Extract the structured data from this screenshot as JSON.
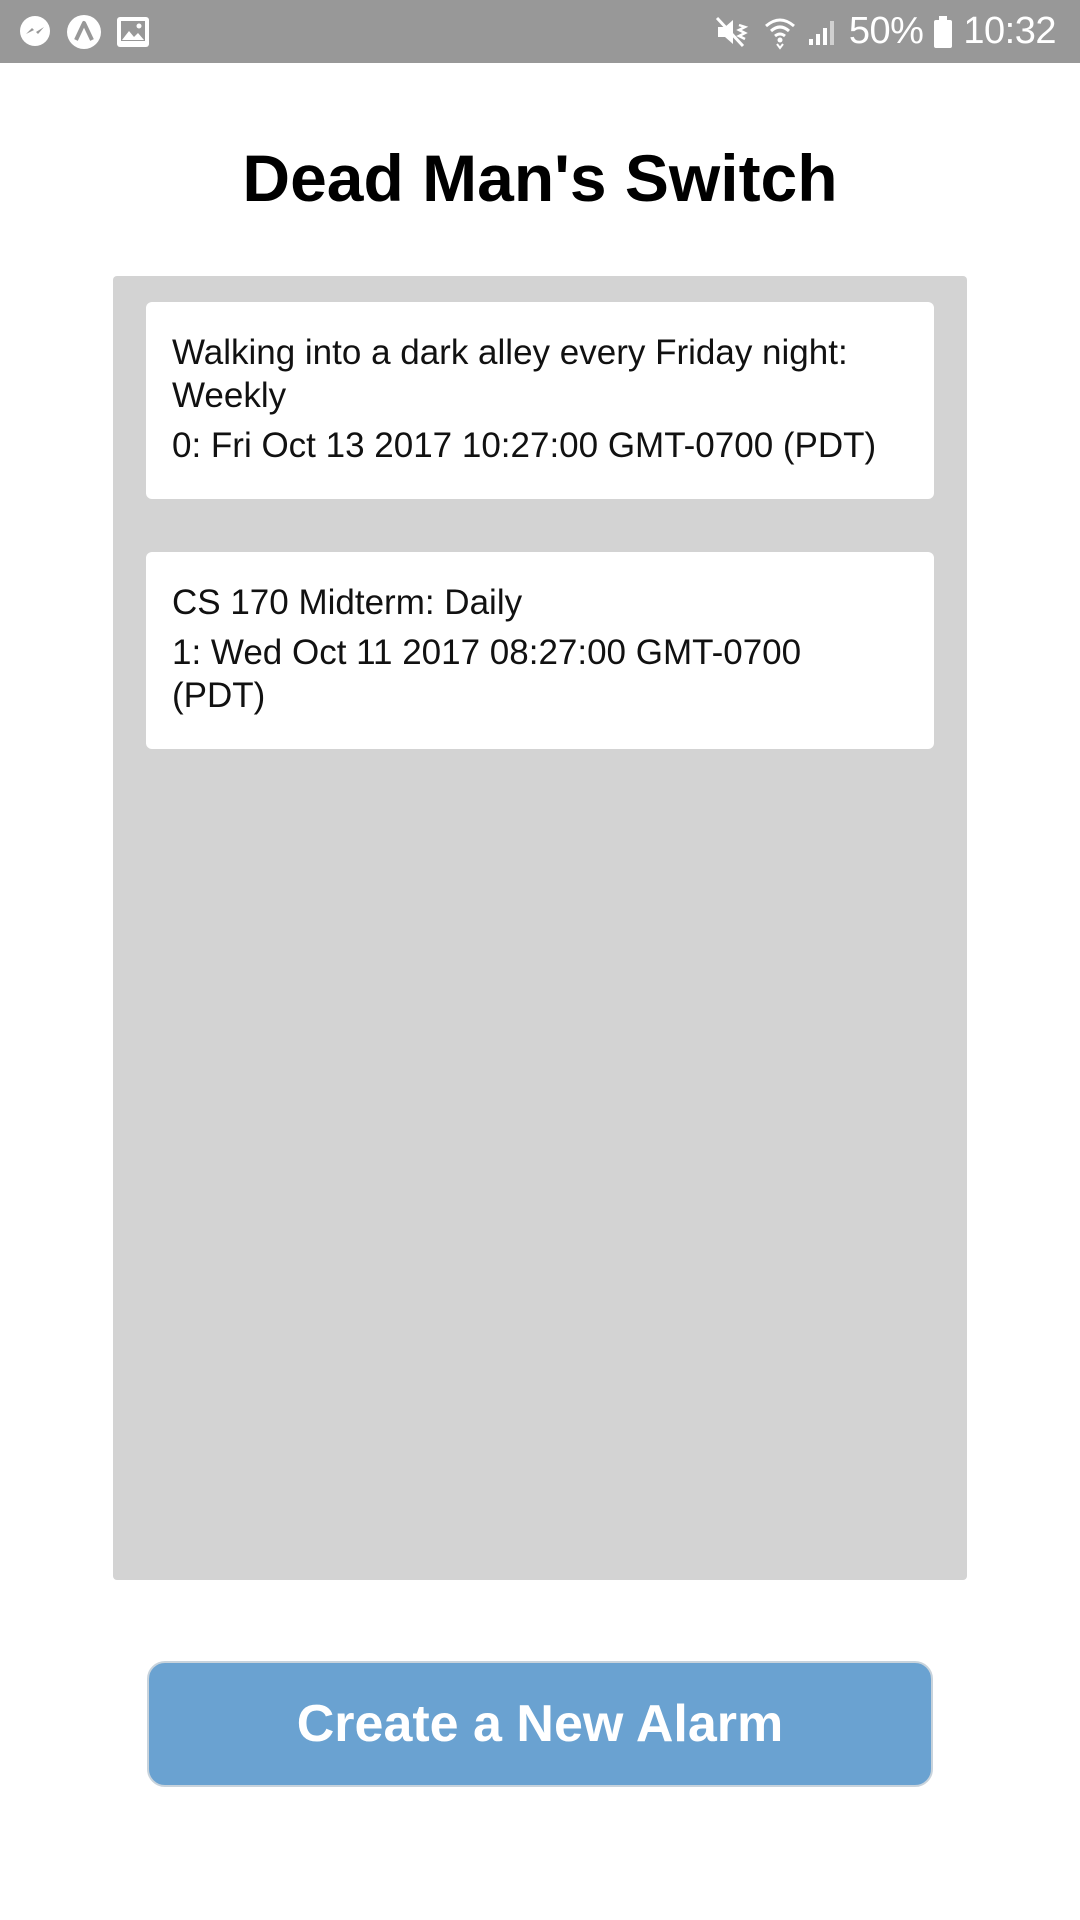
{
  "status_bar": {
    "left_icons": [
      "messenger-icon",
      "app-icon",
      "image-icon"
    ],
    "right_icons": [
      "mute-vibrate-icon",
      "wifi-icon",
      "signal-icon",
      "battery-icon"
    ],
    "battery_percent": "50%",
    "time": "10:32",
    "background": "#989898"
  },
  "page": {
    "title": "Dead Man's Switch"
  },
  "alarms": [
    {
      "name_line": "Walking into a dark alley every Friday night:",
      "name_line_2": "Weekly",
      "time_line": "0: Fri Oct 13 2017 10:27:00 GMT-0700 (PDT)"
    },
    {
      "name_line": "CS 170 Midterm: Daily",
      "time_line": "1: Wed Oct 11 2017 08:27:00 GMT-0700",
      "time_line_2": "(PDT)"
    }
  ],
  "actions": {
    "create_label": "Create a New Alarm",
    "create_color": "#6aa2d1"
  },
  "colors": {
    "panel": "#d3d3d3",
    "card": "#ffffff"
  }
}
